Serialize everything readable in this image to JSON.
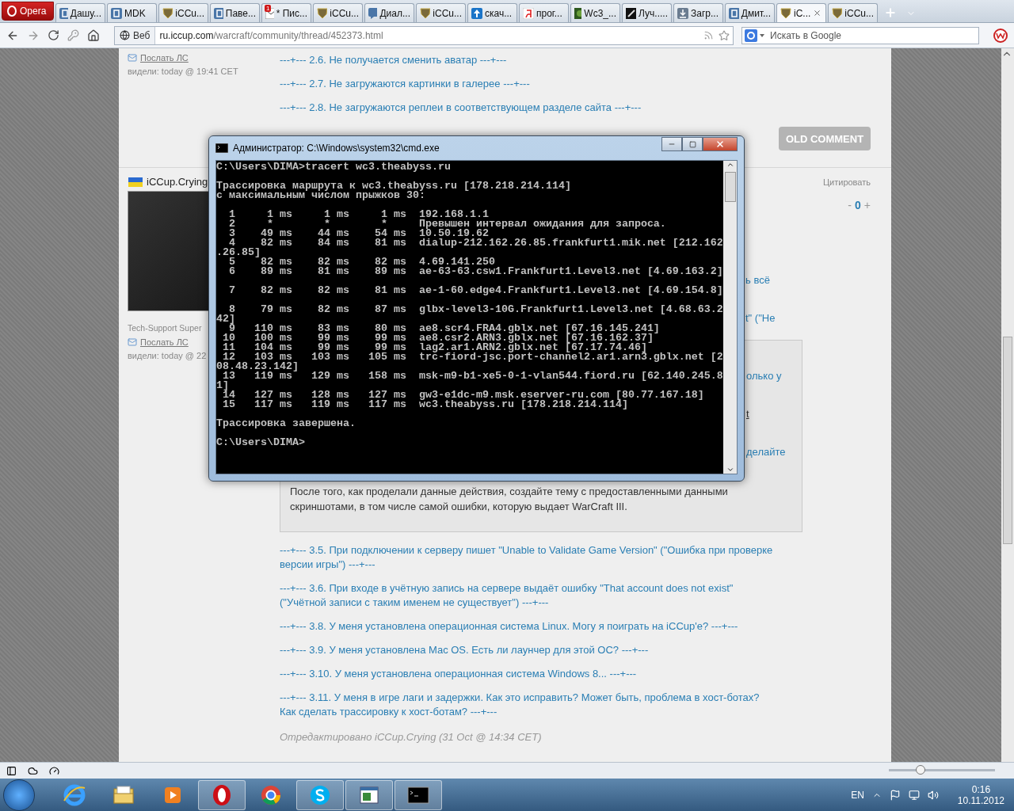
{
  "browser": {
    "menu_label": "Opera",
    "tabs": [
      {
        "label": "Дашу...",
        "kind": "vk",
        "selected": false
      },
      {
        "label": "MDK",
        "kind": "vk",
        "selected": false
      },
      {
        "label": "iCCu...",
        "kind": "shield",
        "selected": false
      },
      {
        "label": "Паве...",
        "kind": "vk",
        "selected": false
      },
      {
        "label": "* Пис...",
        "kind": "mail",
        "selected": false,
        "badge": "1"
      },
      {
        "label": "iCCu...",
        "kind": "shield",
        "selected": false
      },
      {
        "label": "Диал...",
        "kind": "chat",
        "selected": false
      },
      {
        "label": "iCCu...",
        "kind": "shield",
        "selected": false
      },
      {
        "label": "скач...",
        "kind": "upload",
        "selected": false
      },
      {
        "label": "прог...",
        "kind": "yandex",
        "selected": false
      },
      {
        "label": "Wc3_...",
        "kind": "game",
        "selected": false
      },
      {
        "label": "Луч.....",
        "kind": "film",
        "selected": false
      },
      {
        "label": "Загр...",
        "kind": "download",
        "selected": false
      },
      {
        "label": "Дмит...",
        "kind": "vk",
        "selected": false
      },
      {
        "label": "iC...",
        "kind": "shield",
        "selected": true
      },
      {
        "label": "iCCu...",
        "kind": "shield",
        "selected": false
      }
    ],
    "address": {
      "scope": "Веб",
      "host": "ru.iccup.com",
      "path": "/warcraft/community/thread/452373.html"
    },
    "search": {
      "placeholder": "Искать в Google"
    }
  },
  "page": {
    "post_1": {
      "send_pm": "Послать ЛС",
      "seen": "видели: today @ 19:41 CET",
      "links": [
        "---+--- 2.6. Не получается сменить аватар ---+---",
        "---+--- 2.7. Не загружаются картинки в галерее ---+---",
        "---+--- 2.8. Не загружаются реплеи в соответствующем разделе сайта ---+---"
      ],
      "old_comment": "OLD COMMENT"
    },
    "post_2": {
      "author": "iCCup.Crying",
      "quote": "Цитировать",
      "rating": {
        "minus": "-",
        "value": "0",
        "plus": "+"
      },
      "rank": "Tech-Support Super",
      "send_pm": "Послать ЛС",
      "seen": "видели: today @ 22",
      "fragments": [
        {
          "text": "ь всё",
          "kind": "text"
        },
        {
          "text": "t\" (\"Не",
          "kind": "text"
        }
      ],
      "box": {
        "fragments": [
          {
            "text": "олько у",
            "kind": "text"
          },
          {
            "text": "t",
            "kind": "link"
          },
          {
            "text": "делайте",
            "kind": "text"
          }
        ],
        "text": "После того, как проделали данные действия, создайте тему с предоставленными данными скриншотами, в том числе самой ошибки, которую выдает WarCraft III."
      },
      "links": [
        "---+--- 3.5. При подключении к серверу пишет \"Unable to Validate Game Version\" (\"Ошибка при проверке версии игры\") ---+---",
        "---+--- 3.6. При входе в учётную запись на сервере выдаёт ошибку \"That account does not exist\" (\"Учётной записи с таким именем не существует\") ---+---",
        "---+--- 3.8. У меня установлена операционная система Linux. Могу я поиграть на iCCup'e? ---+---",
        "---+--- 3.9. У меня установлена Mac OS. Есть ли лаунчер для этой ОС? ---+---",
        "---+--- 3.10. У меня установлена операционная система Windows 8... ---+---",
        "---+--- 3.11. У меня в игре лаги и задержки. Как это исправить? Может быть, проблема в хост-ботах? Как сделать трассировку к хост-ботам? ---+---"
      ],
      "edited": "Отредактировано iCCup.Crying (31 Oct @ 14:34 CET)"
    }
  },
  "console_window": {
    "title": "Администратор: C:\\Windows\\system32\\cmd.exe",
    "blocks": [
      [
        "C:\\Users\\DIMA>tracert wc3.theabyss.ru"
      ],
      [
        "Трассировка маршрута к wc3.theabyss.ru [178.218.214.114]",
        "с максимальным числом прыжков 30:"
      ],
      [
        "  1     1 ms     1 ms     1 ms  192.168.1.1",
        "  2     *        *        *     Превышен интервал ожидания для запроса.",
        "  3    49 ms    44 ms    54 ms  10.50.19.62",
        "  4    82 ms    84 ms    81 ms  dialup-212.162.26.85.frankfurt1.mik.net [212.162",
        ".26.85]",
        "  5    82 ms    82 ms    82 ms  4.69.141.250",
        "  6    89 ms    81 ms    89 ms  ae-63-63.csw1.Frankfurt1.Level3.net [4.69.163.2]"
      ],
      [
        "  7    82 ms    82 ms    81 ms  ae-1-60.edge4.Frankfurt1.Level3.net [4.69.154.8]"
      ],
      [
        "  8    79 ms    82 ms    87 ms  glbx-level3-10G.Frankfurt1.Level3.net [4.68.63.2",
        "42]",
        "  9   110 ms    83 ms    80 ms  ae8.scr4.FRA4.gblx.net [67.16.145.241]",
        " 10   100 ms    99 ms    99 ms  ae8.csr2.ARN3.gblx.net [67.16.162.37]",
        " 11   104 ms    99 ms    99 ms  lag2.ar1.ARN2.gblx.net [67.17.74.46]",
        " 12   103 ms   103 ms   105 ms  trc-fiord-jsc.port-channel2.ar1.arn3.gblx.net [2",
        "08.48.23.142]",
        " 13   119 ms   129 ms   158 ms  msk-m9-b1-xe5-0-1-vlan544.fiord.ru [62.140.245.8",
        "1]",
        " 14   127 ms   128 ms   127 ms  gw3-e1dc-m9.msk.eserver-ru.com [80.77.167.18]",
        " 15   117 ms   119 ms   117 ms  wc3.theabyss.ru [178.218.214.114]"
      ],
      [
        "Трассировка завершена."
      ],
      [
        "C:\\Users\\DIMA>"
      ]
    ]
  },
  "status_bar": {
    "zoom": {
      "level": 0.3
    }
  },
  "taskbar": {
    "apps": [
      {
        "kind": "ie",
        "active": false
      },
      {
        "kind": "explorer",
        "active": false
      },
      {
        "kind": "media",
        "active": false
      },
      {
        "kind": "opera",
        "active": true
      },
      {
        "kind": "chrome",
        "active": false
      },
      {
        "kind": "skype",
        "active": true
      },
      {
        "kind": "window",
        "active": true
      },
      {
        "kind": "console",
        "active": true
      }
    ],
    "language": "EN",
    "time": "0:16",
    "date": "10.11.2012"
  }
}
